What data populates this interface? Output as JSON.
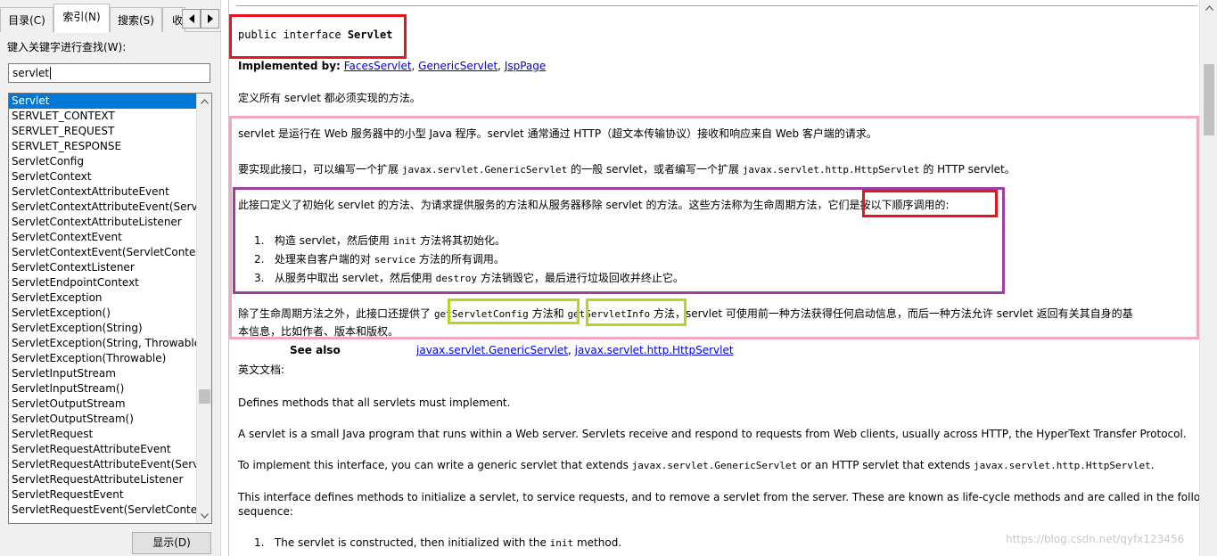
{
  "tabs": [
    {
      "label": "目录(C)"
    },
    {
      "label": "索引(N)"
    },
    {
      "label": "搜索(S)"
    },
    {
      "label": "收"
    }
  ],
  "keyword": {
    "label": "键入关键字进行查找(W):",
    "value": "servlet"
  },
  "index_list": [
    "Servlet",
    "SERVLET_CONTEXT",
    "SERVLET_REQUEST",
    "SERVLET_RESPONSE",
    "ServletConfig",
    "ServletContext",
    "ServletContextAttributeEvent",
    "ServletContextAttributeEvent(Servlet",
    "ServletContextAttributeListener",
    "ServletContextEvent",
    "ServletContextEvent(ServletContext)",
    "ServletContextListener",
    "ServletEndpointContext",
    "ServletException",
    "ServletException()",
    "ServletException(String)",
    "ServletException(String, Throwable)",
    "ServletException(Throwable)",
    "ServletInputStream",
    "ServletInputStream()",
    "ServletOutputStream",
    "ServletOutputStream()",
    "ServletRequest",
    "ServletRequestAttributeEvent",
    "ServletRequestAttributeEvent(Servle",
    "ServletRequestAttributeListener",
    "ServletRequestEvent",
    "ServletRequestEvent(ServletContext"
  ],
  "show_button": "显示(D)",
  "doc": {
    "signature_prefix": "public interface ",
    "signature_name": "Servlet",
    "implemented_by_label": "Implemented by:",
    "implemented_by": [
      "FacesServlet",
      "GenericServlet",
      "JspPage"
    ],
    "sep": ", ",
    "summary_cn": "定义所有 servlet 都必须实现的方法。",
    "p1_cn": "servlet 是运行在 Web 服务器中的小型 Java 程序。servlet 通常通过 HTTP（超文本传输协议）接收和响应来自 Web 客户端的请求。",
    "p2_cn_a": "要实现此接口，可以编写一个扩展 ",
    "p2_cn_code1": "javax.servlet.GenericServlet",
    "p2_cn_b": " 的一般 servlet，或者编写一个扩展 ",
    "p2_cn_code2": "javax.servlet.http.HttpServlet",
    "p2_cn_c": " 的 HTTP servlet。",
    "p3_cn_a": "此接口定义了初始化 servlet 的方法、为请求提供服务的方法和从服务器移除 servlet 的方法。这些方法称为生命周期方法，",
    "p3_cn_b": "它们是按以下顺序调用的:",
    "steps_cn": [
      {
        "num": "1.",
        "a": "构造 servlet，然后使用 ",
        "code": "init",
        "b": " 方法将其初始化。"
      },
      {
        "num": "2.",
        "a": "处理来自客户端的对 ",
        "code": "service",
        "b": " 方法的所有调用。"
      },
      {
        "num": "3.",
        "a": "从服务中取出 servlet，然后使用 ",
        "code": "destroy",
        "b": " 方法销毁它，最后进行垃圾回收并终止它。"
      }
    ],
    "p4_cn_a": "除了生命周期方法之外，此接口还提供了 ",
    "p4_cn_code1": "getServletConfig",
    "p4_cn_b": " 方法和 ",
    "p4_cn_code2": "getServletInfo",
    "p4_cn_c": " 方法，servlet 可使用前一种方法获得任何启动信息，而后一种方法允许 servlet 返回有关其自身的基",
    "p4_cn_d": "本信息，比如作者、版本和版权。",
    "see_also_label": "See also",
    "see_also": [
      "javax.servlet.GenericServlet",
      "javax.servlet.http.HttpServlet"
    ],
    "english_label": "英文文档:",
    "en_p1": "Defines methods that all servlets must implement.",
    "en_p2": "A servlet is a small Java program that runs within a Web server. Servlets receive and respond to requests from Web clients, usually across HTTP, the HyperText Transfer Protocol.",
    "en_p3_a": "To implement this interface, you can write a generic servlet that extends ",
    "en_p3_code1": "javax.servlet.GenericServlet",
    "en_p3_b": " or an HTTP servlet that extends ",
    "en_p3_code2": "javax.servlet.http.HttpServlet",
    "en_p3_c": ".",
    "en_p4_a": "This interface defines methods to initialize a servlet, to service requests, and to remove a servlet from the server. These are known as life-cycle methods and are called in the following",
    "en_p4_b": "sequence:",
    "en_step1_num": "1.",
    "en_step1_a": "The servlet is constructed, then initialized with the ",
    "en_step1_code": "init",
    "en_step1_b": " method."
  },
  "watermark": "https://blog.csdn.net/qyfx123456",
  "colors": {
    "red_box": "#e8141f",
    "pink_box": "#f4a6c2",
    "purple_box": "#9b3fa0",
    "green_box": "#b6d424",
    "selection": "#0078d7",
    "link": "#0000ee"
  }
}
